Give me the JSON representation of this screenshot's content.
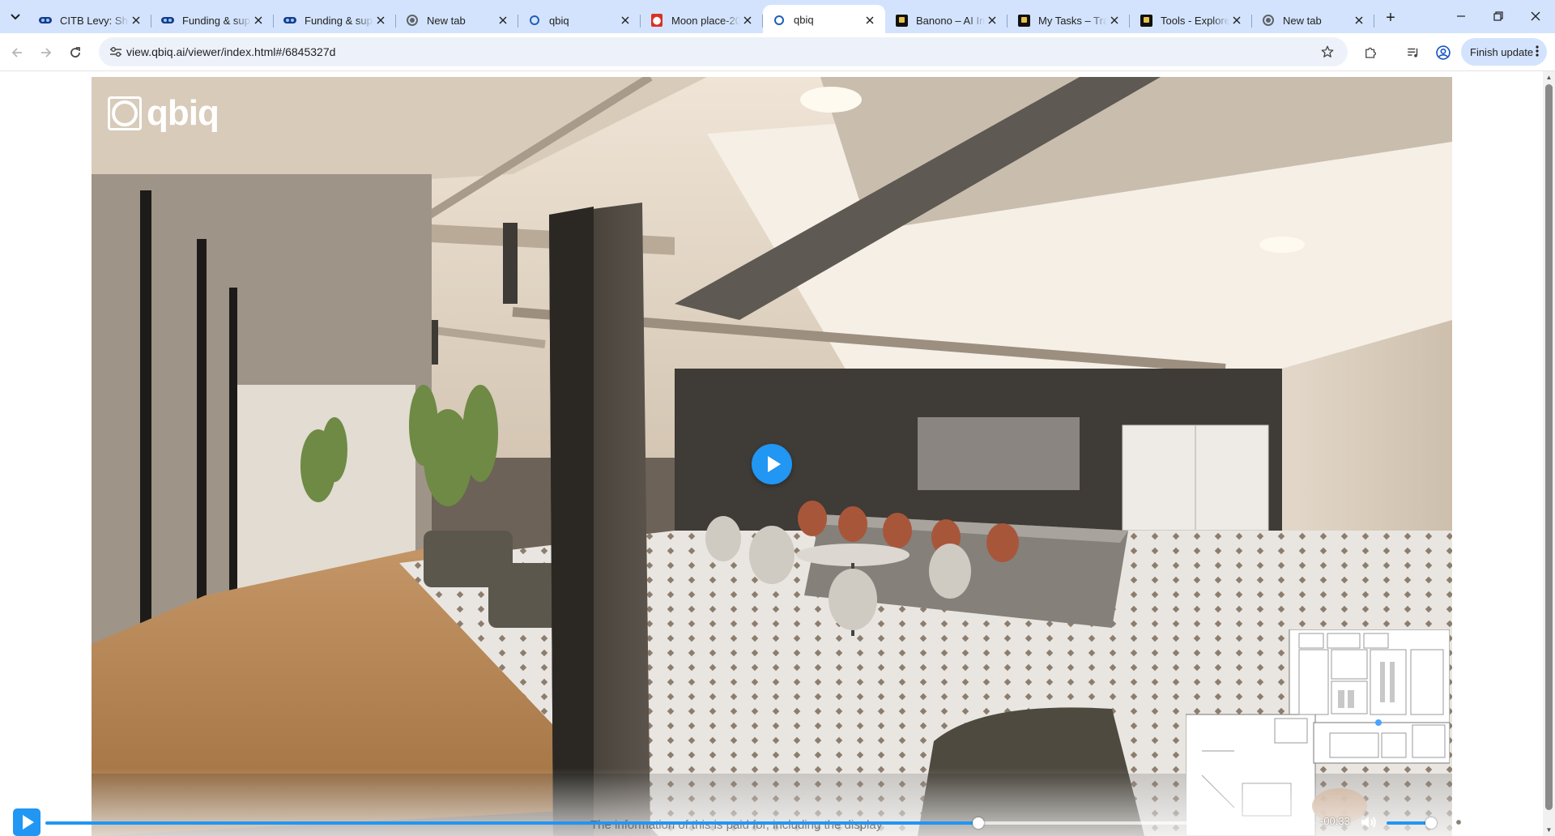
{
  "browser": {
    "tab_search_icon": "chevron-down-icon",
    "tabs": [
      {
        "title": "CITB Levy: Sho",
        "favicon": "citb-icon",
        "active": false
      },
      {
        "title": "Funding & sup",
        "favicon": "citb-icon",
        "active": false
      },
      {
        "title": "Funding & sup",
        "favicon": "citb-icon",
        "active": false
      },
      {
        "title": "New tab",
        "favicon": "chrome-icon",
        "active": false
      },
      {
        "title": "qbiq",
        "favicon": "qbiq-icon",
        "active": false
      },
      {
        "title": "Moon place-20",
        "favicon": "pdf-icon",
        "active": false
      },
      {
        "title": "qbiq",
        "favicon": "qbiq-icon",
        "active": true
      },
      {
        "title": "Banono – AI Im",
        "favicon": "banono-icon",
        "active": false
      },
      {
        "title": "My Tasks – Trac",
        "favicon": "banono-icon",
        "active": false
      },
      {
        "title": "Tools - Explore",
        "favicon": "banono-icon",
        "active": false
      },
      {
        "title": "New tab",
        "favicon": "chrome-icon",
        "active": false
      }
    ],
    "new_tab_label": "+",
    "url": "view.qbiq.ai/viewer/index.html#/6845327d",
    "finish_update_label": "Finish update"
  },
  "player": {
    "logo_text": "qbiq",
    "time_remaining": "-00:33",
    "progress_fraction": 0.735,
    "volume_fraction": 0.88,
    "subtitle_text": "The information of this is paid for, including the display",
    "accent_color": "#2196f3",
    "icons": {
      "play": "play-icon",
      "volume": "volume-icon",
      "settings": "gear-icon",
      "popout": "popout-icon",
      "fullscreen": "fullscreen-icon"
    }
  }
}
